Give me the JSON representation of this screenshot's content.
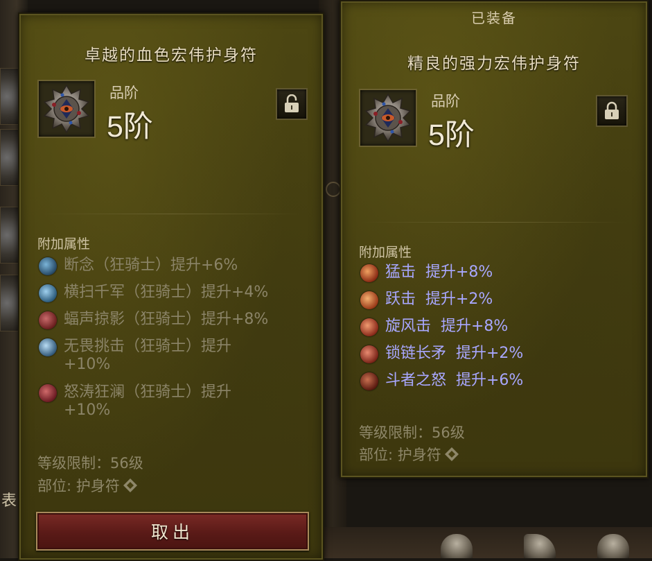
{
  "left_item": {
    "title": "卓越的血色宏伟护身符",
    "quality_label": "品阶",
    "quality_value": "5阶",
    "lock_state": "unlocked",
    "section_label": "附加属性",
    "affixes": [
      {
        "icon": "slash-skill-icon",
        "text": "断念（狂骑士）提升+6%"
      },
      {
        "icon": "sweep-skill-icon",
        "text": "横扫千军（狂骑士）提升+4%"
      },
      {
        "icon": "bat-skill-icon",
        "text": "蝠声掠影（狂骑士）提升+8%"
      },
      {
        "icon": "lightning-skill-icon",
        "text": "无畏挑击（狂骑士）提升\n+10%"
      },
      {
        "icon": "rage-skill-icon",
        "text": "怒涛狂澜（狂骑士）提升\n+10%"
      }
    ],
    "level_requirement": "等级限制：56级",
    "slot": "部位: 护身符",
    "take_button": "取出"
  },
  "right_item": {
    "equipped_label": "已装备",
    "title": "精良的强力宏伟护身符",
    "quality_label": "品阶",
    "quality_value": "5阶",
    "lock_state": "locked",
    "section_label": "附加属性",
    "affixes": [
      {
        "icon": "bash-skill-icon",
        "text": "猛击  提升+8%"
      },
      {
        "icon": "leap-skill-icon",
        "text": "跃击  提升+2%"
      },
      {
        "icon": "whirlwind-skill-icon",
        "text": "旋风击  提升+8%"
      },
      {
        "icon": "chain-spear-skill-icon",
        "text": "锁链长矛  提升+2%"
      },
      {
        "icon": "fury-skill-icon",
        "text": "斗者之怒  提升+6%"
      }
    ],
    "level_requirement": "等级限制：56级",
    "slot": "部位: 护身符"
  },
  "background": {
    "partial_text": "表"
  },
  "colors": {
    "panel": "#463f10",
    "affix_inactive": "#8b8468",
    "affix_active": "#a8a7ff",
    "button_red": "#6a201c"
  }
}
